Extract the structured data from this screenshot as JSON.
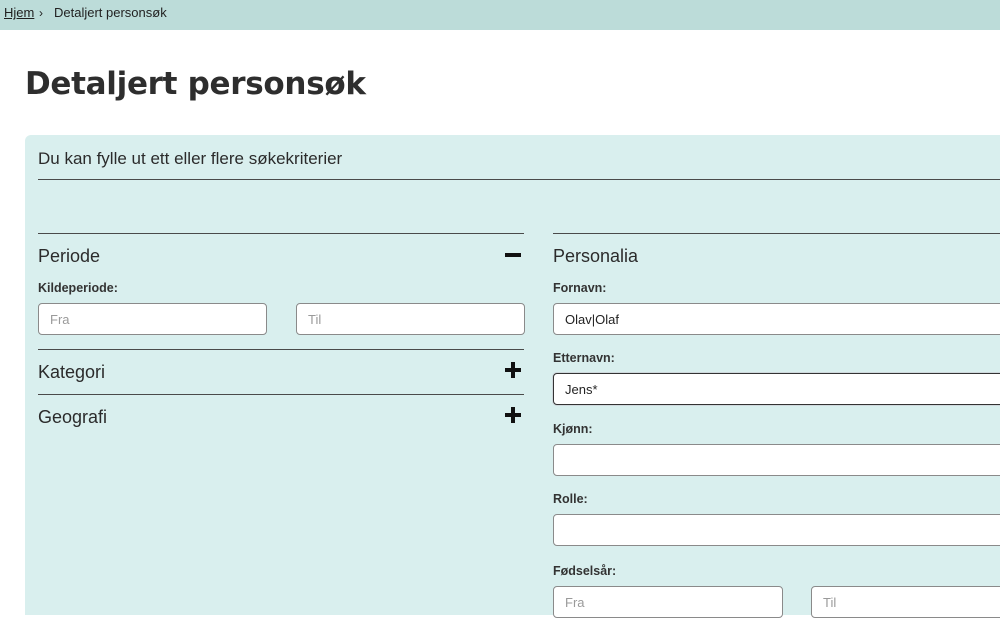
{
  "breadcrumb": {
    "home": "Hjem",
    "separator": "›",
    "current": "Detaljert personsøk"
  },
  "page": {
    "title": "Detaljert personsøk"
  },
  "form": {
    "intro": "Du kan fylle ut ett eller flere søkekriterier",
    "periode": {
      "title": "Periode",
      "kildeperiode_label": "Kildeperiode:",
      "fra_placeholder": "Fra",
      "til_placeholder": "Til"
    },
    "kategori": {
      "title": "Kategori"
    },
    "geografi": {
      "title": "Geografi"
    },
    "personalia": {
      "title": "Personalia",
      "fornavn_label": "Fornavn:",
      "fornavn_value": "Olav|Olaf",
      "etternavn_label": "Etternavn:",
      "etternavn_value": "Jens*",
      "kjonn_label": "Kjønn:",
      "kjonn_value": "",
      "rolle_label": "Rolle:",
      "rolle_value": "",
      "fodselsar_label": "Fødselsår:",
      "fodselsar_fra_placeholder": "Fra",
      "fodselsar_til_placeholder": "Til"
    }
  },
  "icons": {
    "periode_toggle": "minus-icon",
    "kategori_toggle": "plus-icon",
    "geografi_toggle": "plus-icon"
  },
  "colors": {
    "topbar": "#bcdcd9",
    "panel": "#d9efee"
  }
}
